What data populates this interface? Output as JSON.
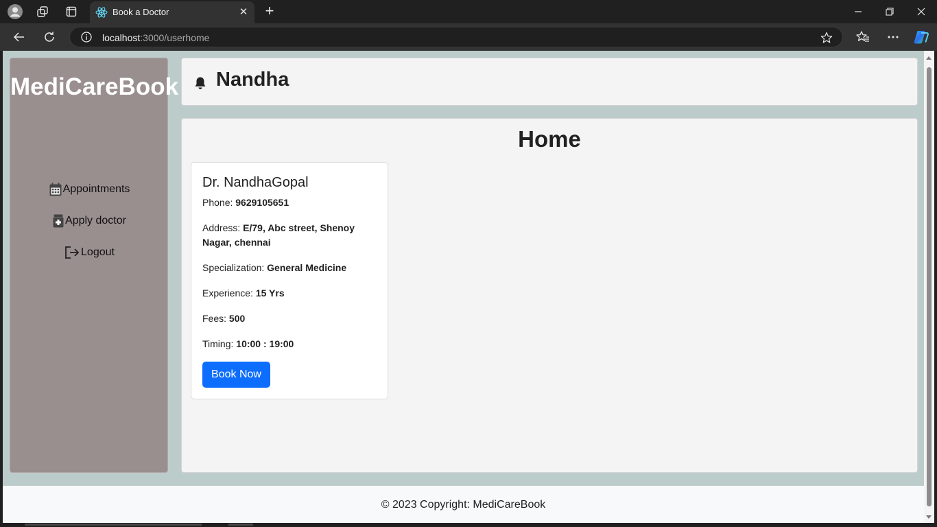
{
  "browser": {
    "tab_title": "Book a Doctor",
    "url_host": "localhost",
    "url_path": ":3000/userhome"
  },
  "sidebar": {
    "brand": "MediCareBook",
    "items": [
      {
        "label": "Appointments",
        "icon": "calendar-icon"
      },
      {
        "label": "Apply doctor",
        "icon": "medical-bag-icon"
      },
      {
        "label": "Logout",
        "icon": "logout-icon"
      }
    ]
  },
  "header": {
    "user_name": "Nandha",
    "icon": "bell-icon"
  },
  "main": {
    "title": "Home",
    "doctor": {
      "name": "Dr. NandhaGopal",
      "phone_label": "Phone:",
      "phone": "9629105651",
      "address_label": "Address:",
      "address": "E/79, Abc street, Shenoy Nagar, chennai",
      "specialization_label": "Specialization:",
      "specialization": "General Medicine",
      "experience_label": "Experience:",
      "experience": "15 Yrs",
      "fees_label": "Fees:",
      "fees": "500",
      "timing_label": "Timing:",
      "timing": "10:00 : 19:00",
      "book_button": "Book Now"
    }
  },
  "footer": {
    "text": "© 2023 Copyright: MediCareBook"
  },
  "colors": {
    "sidebar_bg": "#9a8f8f",
    "page_bg": "#bccccb",
    "button_primary": "#0d6efd"
  }
}
